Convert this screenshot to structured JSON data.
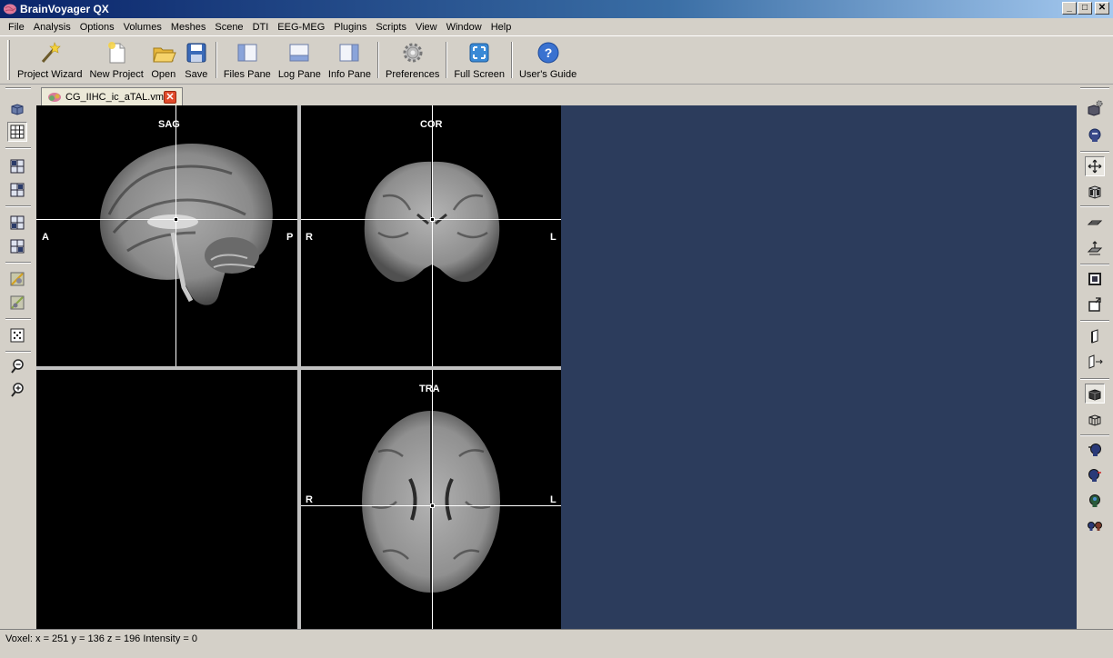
{
  "window": {
    "title": "BrainVoyager QX"
  },
  "menu": [
    "File",
    "Analysis",
    "Options",
    "Volumes",
    "Meshes",
    "Scene",
    "DTI",
    "EEG-MEG",
    "Plugins",
    "Scripts",
    "View",
    "Window",
    "Help"
  ],
  "toolbar": {
    "project_wizard": "Project Wizard",
    "new_project": "New Project",
    "open": "Open",
    "save": "Save",
    "files_pane": "Files Pane",
    "log_pane": "Log Pane",
    "info_pane": "Info Pane",
    "preferences": "Preferences",
    "full_screen": "Full Screen",
    "users_guide": "User's Guide"
  },
  "document_tab": {
    "label": "CG_IIHC_ic_aTAL.vmr"
  },
  "views": {
    "sag": {
      "title": "SAG",
      "left": "A",
      "right": "P"
    },
    "cor": {
      "title": "COR",
      "left": "R",
      "right": "L"
    },
    "tra": {
      "title": "TRA",
      "left": "R",
      "right": "L"
    }
  },
  "status": {
    "text": "Voxel:  x = 251 y = 136 z = 196  Intensity = 0"
  },
  "colors": {
    "viewer_background": "#2c3c5c",
    "title_bar": "#0a246a"
  }
}
